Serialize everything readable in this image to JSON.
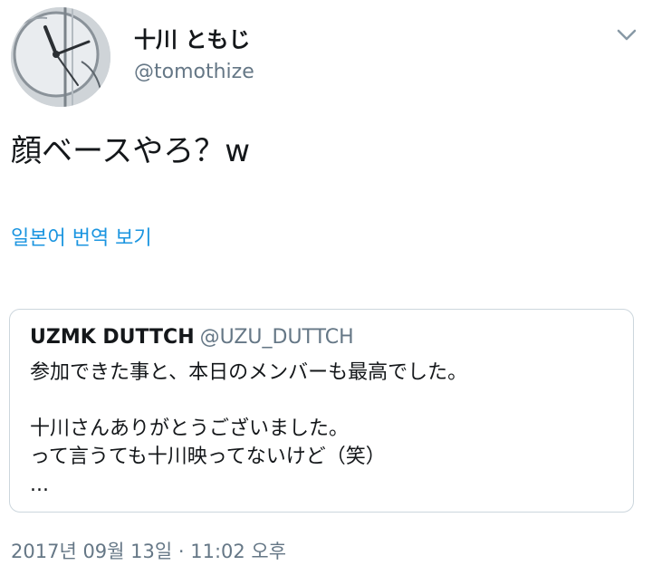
{
  "author": {
    "display_name": "十川 ともじ",
    "username": "@tomothize"
  },
  "tweet": {
    "text": "顔ベースやろ？w",
    "translate_link": "일본어 번역 보기",
    "timestamp": "2017년 09월 13일 · 11:02 오후"
  },
  "quoted_tweet": {
    "author_name": "UZMK DUTTCH",
    "author_handle": "@UZU_DUTTCH",
    "lines": [
      "参加できた事と、本日のメンバーも最高でした。",
      "",
      "十川さんありがとうございました。",
      "って言うても十川映ってないけど（笑）",
      "..."
    ]
  },
  "icons": {
    "menu": "chevron-down-icon",
    "avatar": "clock-photo"
  },
  "colors": {
    "text": "#14171a",
    "secondary": "#657786",
    "link": "#1b95e0",
    "border": "#ccd6dd"
  }
}
